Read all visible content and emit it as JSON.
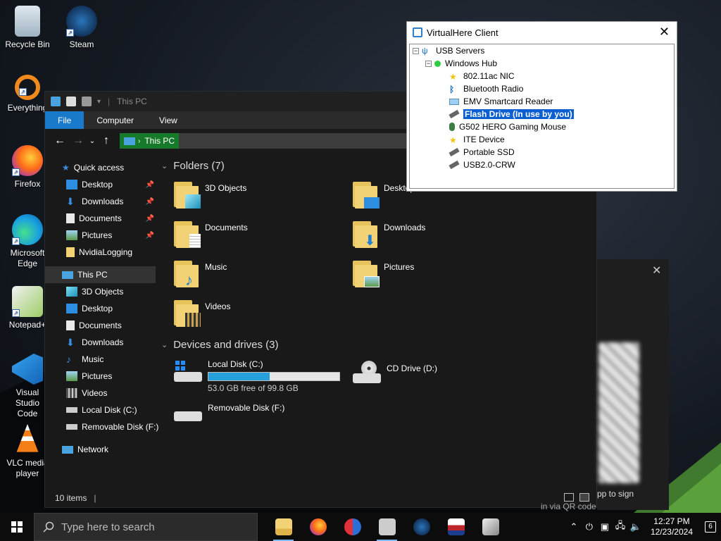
{
  "desktop": {
    "icons": [
      {
        "label": "Recycle Bin",
        "icon": "recycle-bin-icon"
      },
      {
        "label": "Steam",
        "icon": "steam-icon"
      },
      {
        "label": "Everything",
        "icon": "everything-icon"
      },
      {
        "label": "Firefox",
        "icon": "firefox-icon"
      },
      {
        "label": "Microsoft Edge",
        "icon": "edge-icon"
      },
      {
        "label": "Notepad+",
        "icon": "notepad-plus-icon"
      },
      {
        "label": "Visual Studio Code",
        "icon": "vscode-icon"
      },
      {
        "label": "VLC media player",
        "icon": "vlc-icon"
      }
    ]
  },
  "explorer": {
    "title": "This PC",
    "tabs": [
      "File",
      "Computer",
      "View"
    ],
    "address": "This PC",
    "sidebar": {
      "quick_access": "Quick access",
      "quick_items": [
        "Desktop",
        "Downloads",
        "Documents",
        "Pictures",
        "NvidiaLogging"
      ],
      "this_pc": "This PC",
      "pc_items": [
        "3D Objects",
        "Desktop",
        "Documents",
        "Downloads",
        "Music",
        "Pictures",
        "Videos",
        "Local Disk (C:)",
        "Removable Disk (F:)"
      ],
      "network": "Network"
    },
    "folders_heading": "Folders (7)",
    "folders": [
      "3D Objects",
      "Desktop",
      "Documents",
      "Downloads",
      "Music",
      "Pictures",
      "Videos"
    ],
    "drives_heading": "Devices and drives (3)",
    "drives": [
      {
        "name": "Local Disk (C:)",
        "free": "53.0 GB free of 99.8 GB",
        "used_fraction": 0.469
      },
      {
        "name": "CD Drive (D:)"
      },
      {
        "name": "Removable Disk (F:)"
      }
    ],
    "status": "10 items"
  },
  "virtualhere": {
    "title": "VirtualHere Client",
    "root": "USB Servers",
    "hub": "Windows Hub",
    "devices": [
      {
        "label": "802.11ac NIC",
        "icon": "star-icon"
      },
      {
        "label": "Bluetooth Radio",
        "icon": "bluetooth-icon"
      },
      {
        "label": "EMV Smartcard Reader",
        "icon": "smartcard-icon"
      },
      {
        "label": "Flash Drive (In use by you)",
        "icon": "usb-drive-icon",
        "selected": true
      },
      {
        "label": "G502 HERO Gaming Mouse",
        "icon": "mouse-icon"
      },
      {
        "label": "ITE Device",
        "icon": "star-icon"
      },
      {
        "label": "Portable SSD",
        "icon": "usb-drive-icon"
      },
      {
        "label": "USB2.0-CRW",
        "icon": "usb-drive-icon"
      }
    ]
  },
  "notification": {
    "text1": "pp to sign",
    "text2": "in via QR code"
  },
  "taskbar": {
    "search_placeholder": "Type here to search",
    "time": "12:27 PM",
    "date": "12/23/2024",
    "notification_count": "6"
  }
}
